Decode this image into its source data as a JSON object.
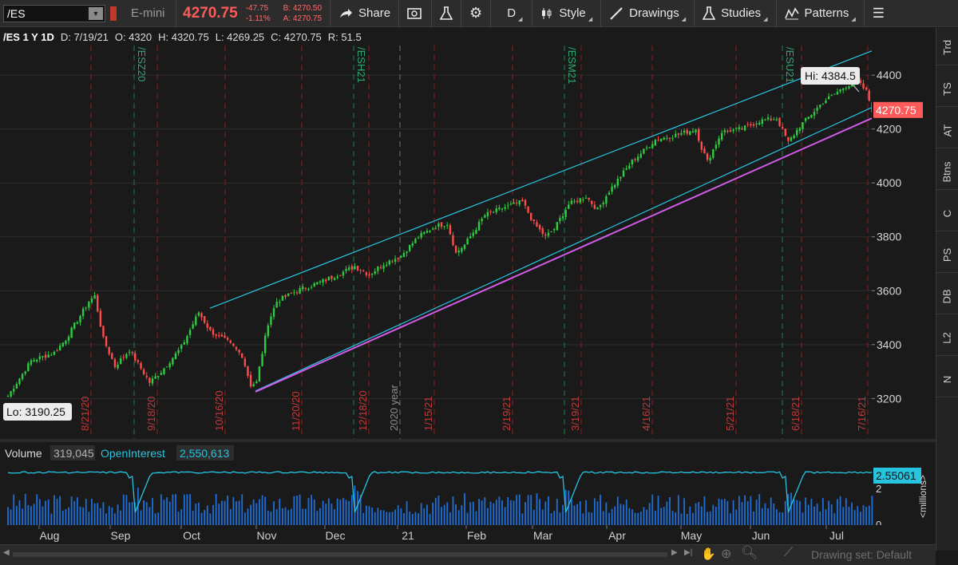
{
  "toolbar": {
    "symbol": "/ES",
    "description": "E-mini",
    "last": "4270.75",
    "net_change": "-47.75",
    "pct_change": "-1.11%",
    "bid": "B: 4270.50",
    "ask": "A: 4270.75",
    "share": "Share",
    "aggregation": "D",
    "style": "Style",
    "drawings": "Drawings",
    "studies": "Studies",
    "patterns": "Patterns"
  },
  "header": {
    "title": "/ES 1 Y 1D",
    "date": "D: 7/19/21",
    "open": "O: 4320",
    "high": "H: 4320.75",
    "low": "L: 4269.25",
    "close": "C: 4270.75",
    "range": "R: 51.5"
  },
  "side_tabs": [
    "Trd",
    "TS",
    "AT",
    "Btns",
    "C",
    "PS",
    "DB",
    "L2",
    "N"
  ],
  "colors": {
    "up": "#2ecc40",
    "down": "#ff4c4c",
    "channel": "#27c4e0",
    "trendline": "#d25ce8",
    "volume": "#1e6fd9",
    "open_interest": "#27c4e0",
    "price_tag": "#ff5a5a"
  },
  "chart_data": {
    "type": "candlestick",
    "title": "/ES 1 Y 1D",
    "y_ticks": [
      3200,
      3400,
      3600,
      3800,
      4000,
      4200,
      4400
    ],
    "ylim": [
      3050,
      4510
    ],
    "last_price": "4270.75",
    "hi_label": "Hi: 4384.5",
    "lo_label": "Lo: 3190.25",
    "months": [
      "Aug",
      "Sep",
      "Oct",
      "Nov",
      "Dec",
      "21",
      "Feb",
      "Mar",
      "Apr",
      "May",
      "Jun",
      "Jul"
    ],
    "date_markers": [
      "8/21/20",
      "9/18/20",
      "10/16/20",
      "11/20/20",
      "12/18/20",
      "1/15/21",
      "2/19/21",
      "3/19/21",
      "4/16/21",
      "5/21/21",
      "6/18/21",
      "7/16/21"
    ],
    "expiry_markers": [
      "/ESZ20",
      "/ESH21",
      "/ESM21",
      "/ESU21"
    ],
    "year_marker": "2020 year",
    "anchors": [
      {
        "t": 0,
        "p": 3210
      },
      {
        "t": 8,
        "p": 3340
      },
      {
        "t": 16,
        "p": 3370
      },
      {
        "t": 20,
        "p": 3420
      },
      {
        "t": 28,
        "p": 3560
      },
      {
        "t": 30,
        "p": 3580
      },
      {
        "t": 33,
        "p": 3420
      },
      {
        "t": 37,
        "p": 3320
      },
      {
        "t": 42,
        "p": 3380
      },
      {
        "t": 49,
        "p": 3260
      },
      {
        "t": 53,
        "p": 3300
      },
      {
        "t": 60,
        "p": 3390
      },
      {
        "t": 66,
        "p": 3520
      },
      {
        "t": 70,
        "p": 3450
      },
      {
        "t": 76,
        "p": 3410
      },
      {
        "t": 81,
        "p": 3360
      },
      {
        "t": 84,
        "p": 3250
      },
      {
        "t": 86,
        "p": 3260
      },
      {
        "t": 90,
        "p": 3480
      },
      {
        "t": 93,
        "p": 3560
      },
      {
        "t": 100,
        "p": 3600
      },
      {
        "t": 110,
        "p": 3640
      },
      {
        "t": 120,
        "p": 3690
      },
      {
        "t": 125,
        "p": 3660
      },
      {
        "t": 130,
        "p": 3700
      },
      {
        "t": 136,
        "p": 3730
      },
      {
        "t": 142,
        "p": 3800
      },
      {
        "t": 148,
        "p": 3840
      },
      {
        "t": 152,
        "p": 3850
      },
      {
        "t": 155,
        "p": 3740
      },
      {
        "t": 158,
        "p": 3770
      },
      {
        "t": 165,
        "p": 3880
      },
      {
        "t": 172,
        "p": 3910
      },
      {
        "t": 178,
        "p": 3930
      },
      {
        "t": 182,
        "p": 3850
      },
      {
        "t": 186,
        "p": 3800
      },
      {
        "t": 189,
        "p": 3830
      },
      {
        "t": 194,
        "p": 3920
      },
      {
        "t": 200,
        "p": 3950
      },
      {
        "t": 204,
        "p": 3900
      },
      {
        "t": 208,
        "p": 3970
      },
      {
        "t": 216,
        "p": 4080
      },
      {
        "t": 224,
        "p": 4160
      },
      {
        "t": 232,
        "p": 4180
      },
      {
        "t": 238,
        "p": 4200
      },
      {
        "t": 240,
        "p": 4130
      },
      {
        "t": 242,
        "p": 4080
      },
      {
        "t": 247,
        "p": 4190
      },
      {
        "t": 254,
        "p": 4200
      },
      {
        "t": 260,
        "p": 4230
      },
      {
        "t": 266,
        "p": 4240
      },
      {
        "t": 270,
        "p": 4150
      },
      {
        "t": 274,
        "p": 4210
      },
      {
        "t": 282,
        "p": 4300
      },
      {
        "t": 290,
        "p": 4360
      },
      {
        "t": 294,
        "p": 4375
      },
      {
        "t": 297,
        "p": 4340
      },
      {
        "t": 299,
        "p": 4270
      }
    ],
    "volume_series": "Volume",
    "volume_value": "319,045",
    "oi_series": "OpenInterest",
    "oi_value": "2,550,613",
    "oi_tag": "2.55061",
    "volume_ticks": [
      "2",
      "0"
    ],
    "volume_unit": "<millions>"
  },
  "bottom": {
    "drawing_set": "Drawing set: Default"
  }
}
